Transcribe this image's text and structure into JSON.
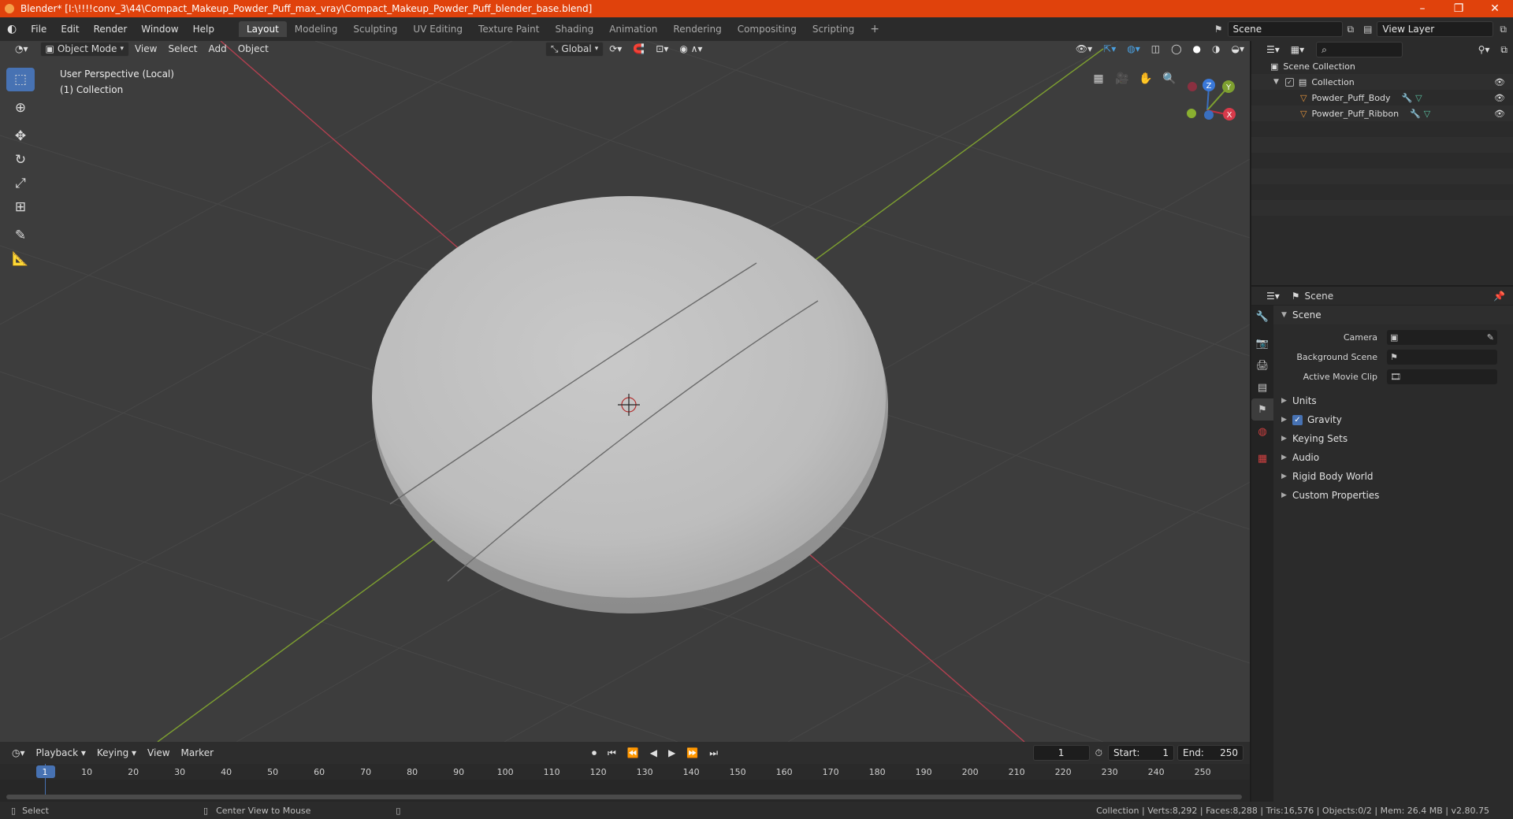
{
  "titlebar": {
    "title": "Blender* [I:\\!!!!conv_3\\44\\Compact_Makeup_Powder_Puff_max_vray\\Compact_Makeup_Powder_Puff_blender_base.blend]",
    "minimize": "–",
    "restore": "❐",
    "close": "✕"
  },
  "menubar": {
    "menus": [
      "File",
      "Edit",
      "Render",
      "Window",
      "Help"
    ],
    "workspaces": [
      "Layout",
      "Modeling",
      "Sculpting",
      "UV Editing",
      "Texture Paint",
      "Shading",
      "Animation",
      "Rendering",
      "Compositing",
      "Scripting"
    ],
    "active_workspace": "Layout",
    "add_tab": "+",
    "scene_label": "Scene",
    "view_layer_label": "View Layer"
  },
  "viewport_header": {
    "mode": "Object Mode",
    "menus": [
      "View",
      "Select",
      "Add",
      "Object"
    ],
    "orientation": "Global"
  },
  "viewport": {
    "info_line1": "User Perspective (Local)",
    "info_line2": "(1) Collection",
    "background": "#3d3d3d",
    "x_axis_color": "#b34050",
    "y_axis_color": "#7ea030",
    "gizmo": {
      "z": "Z",
      "y": "Y",
      "x": "X"
    }
  },
  "toolbar_tools": [
    "select-box-icon",
    "cursor-icon",
    "move-icon",
    "rotate-icon",
    "scale-icon",
    "transform-icon",
    "annotate-icon",
    "measure-icon"
  ],
  "timeline": {
    "menus": [
      "Playback",
      "Keying",
      "View",
      "Marker"
    ],
    "current_frame": "1",
    "start_label": "Start:",
    "start_value": "1",
    "end_label": "End:",
    "end_value": "250",
    "ticks": [
      "1",
      "10",
      "20",
      "30",
      "40",
      "50",
      "60",
      "70",
      "80",
      "90",
      "100",
      "110",
      "120",
      "130",
      "140",
      "150",
      "160",
      "170",
      "180",
      "190",
      "200",
      "210",
      "220",
      "230",
      "240",
      "250"
    ]
  },
  "statusbar": {
    "select": "Select",
    "center_view": "Center View to Mouse",
    "stats": "Collection | Verts:8,292 | Faces:8,288 | Tris:16,576 | Objects:0/2 | Mem: 26.4 MB | v2.80.75"
  },
  "outliner": {
    "scene_collection": "Scene Collection",
    "collection": "Collection",
    "objects": [
      "Powder_Puff_Body",
      "Powder_Puff_Ribbon"
    ]
  },
  "properties": {
    "header": "Scene",
    "section": "Scene",
    "camera_label": "Camera",
    "background_scene_label": "Background Scene",
    "active_movie_clip_label": "Active Movie Clip",
    "subpanels": [
      "Units",
      "Gravity",
      "Keying Sets",
      "Audio",
      "Rigid Body World",
      "Custom Properties"
    ]
  },
  "colors": {
    "titlebar": "#e0420c",
    "accent": "#4772b3"
  }
}
